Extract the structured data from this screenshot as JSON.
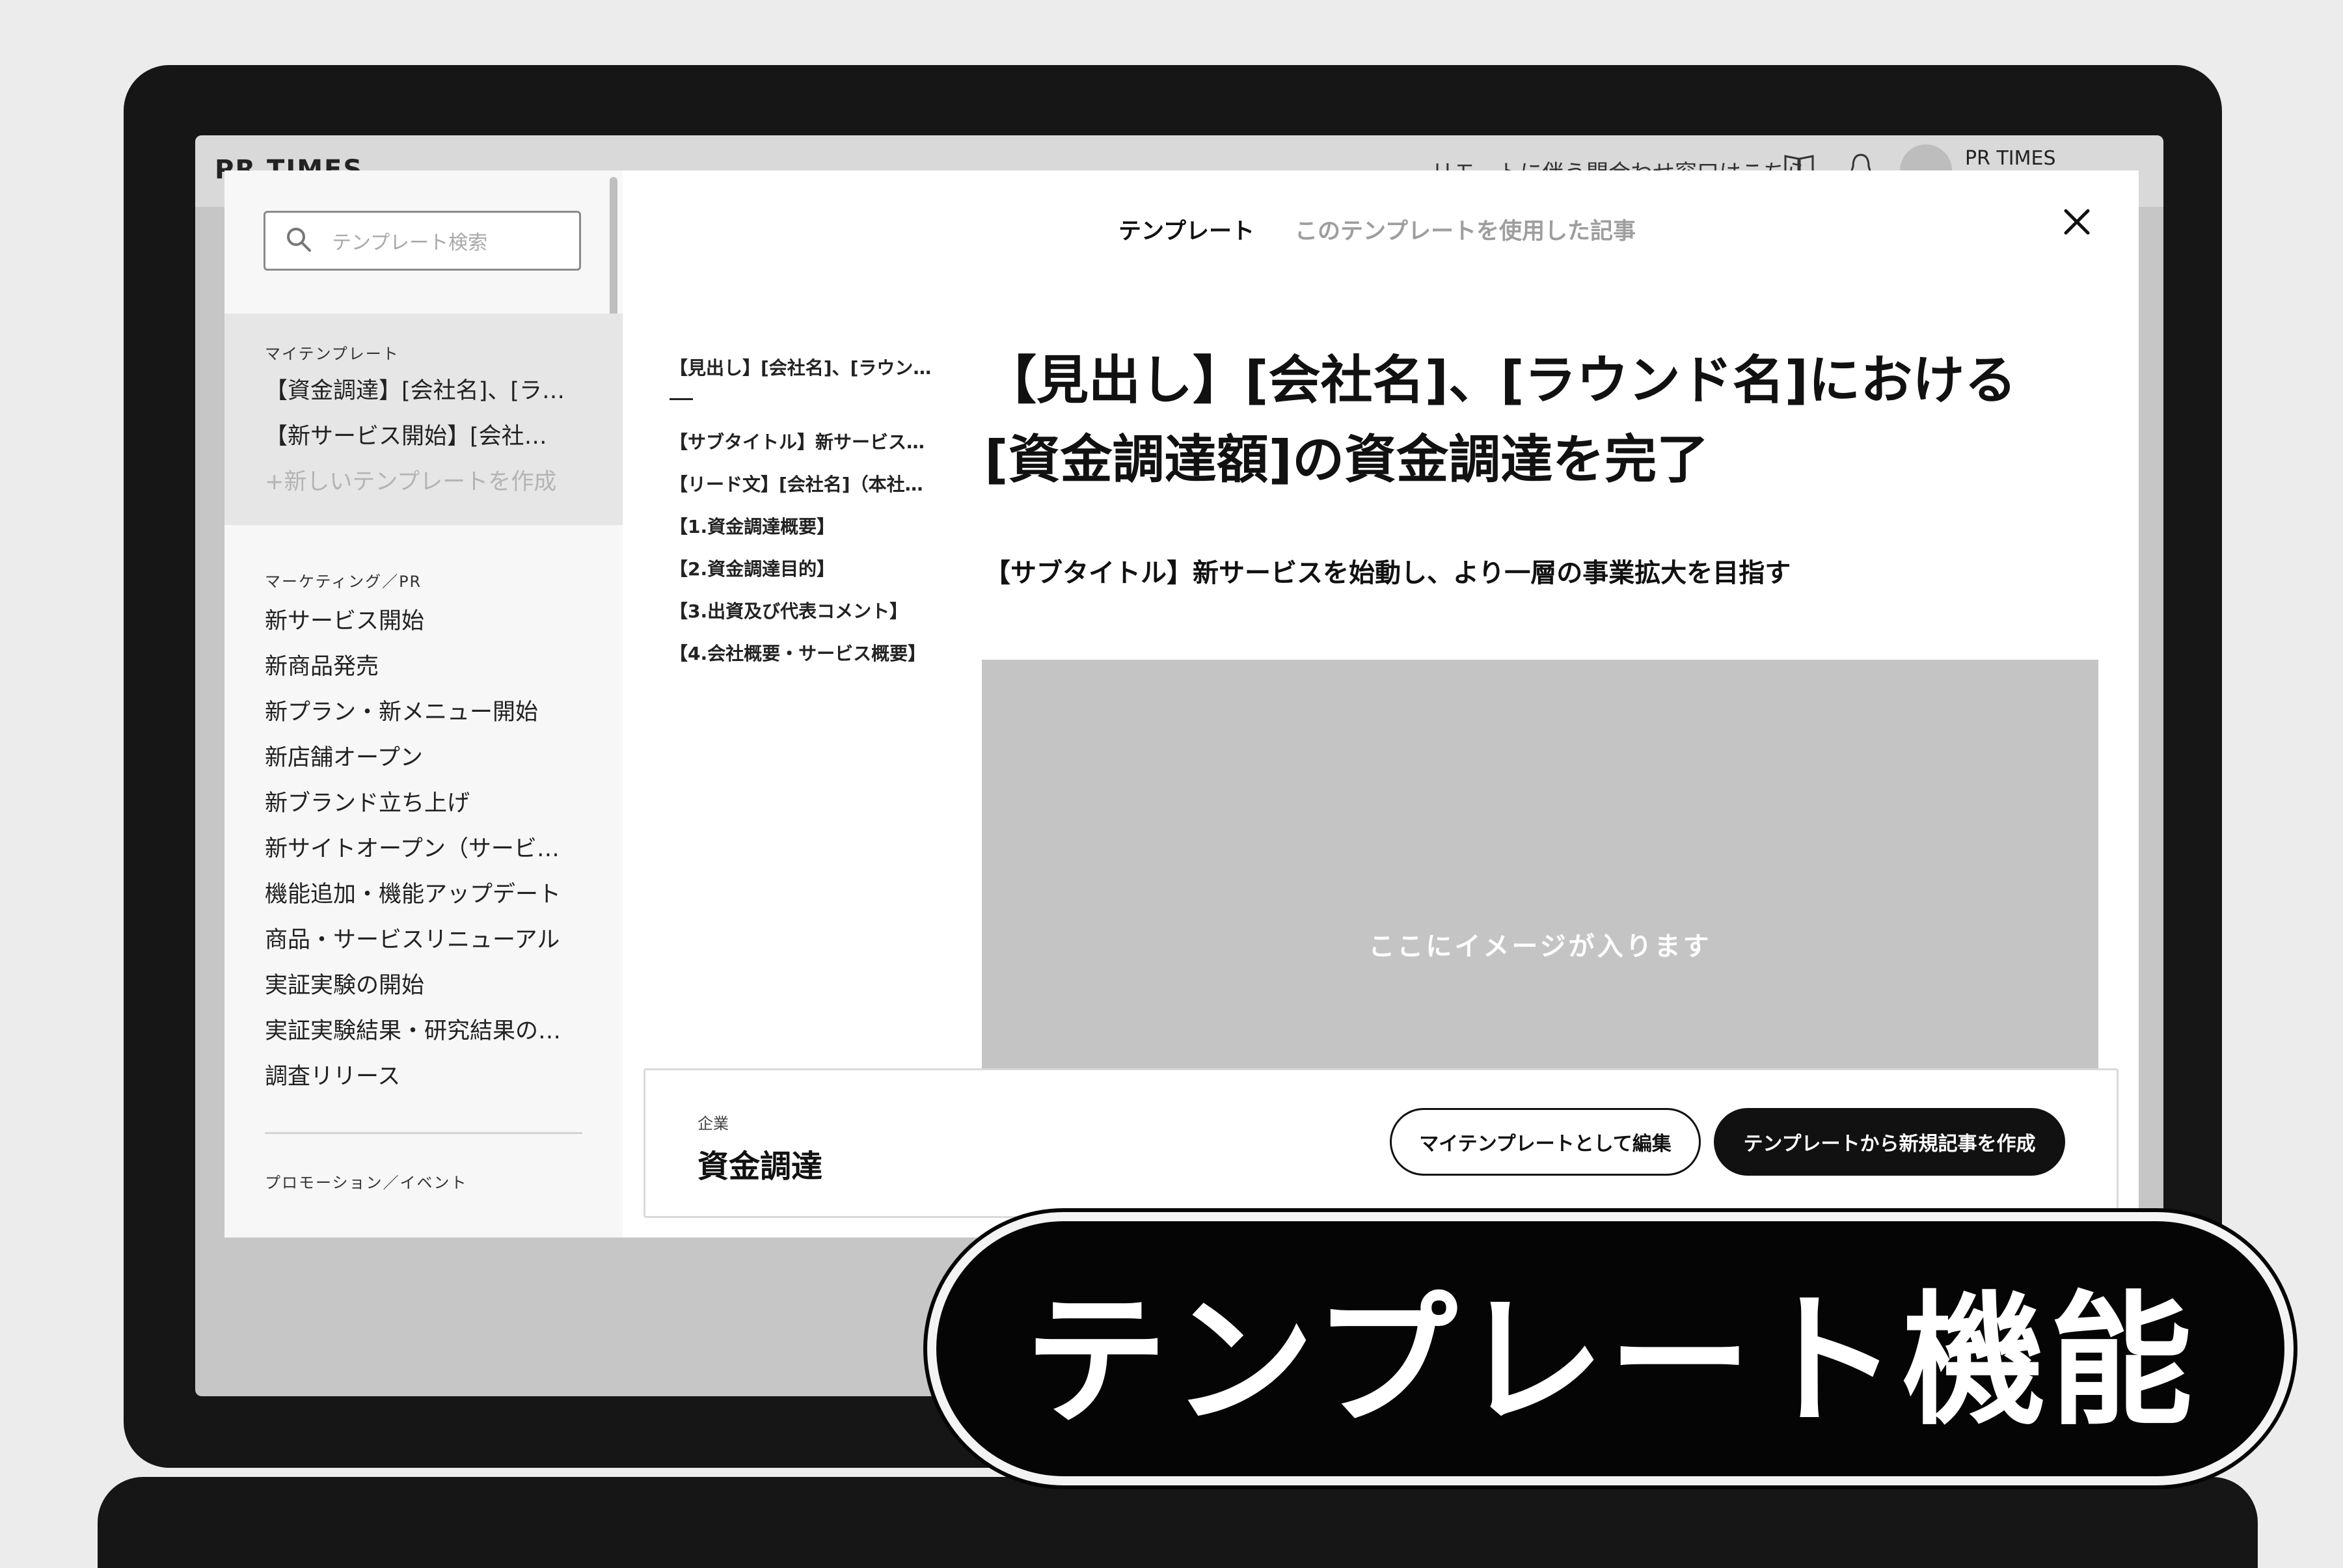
{
  "topbar": {
    "logo": "PR TIMES",
    "link": "リモートに伴う問合わせ窓口はこちら",
    "book_icon": "book-icon",
    "bell_icon": "bell-icon",
    "user_name": "PR TIMES"
  },
  "sidebar": {
    "search_placeholder": "テンプレート検索",
    "my_templates": {
      "label": "マイテンプレート",
      "items": [
        "【資金調達】[会社名]、[ラ…",
        "【新サービス開始】[会社…"
      ],
      "create_label": "+新しいテンプレートを作成"
    },
    "marketing": {
      "label": "マーケティング／PR",
      "items": [
        "新サービス開始",
        "新商品発売",
        "新プラン・新メニュー開始",
        "新店舗オープン",
        "新ブランド立ち上げ",
        "新サイトオープン（サービ…",
        "機能追加・機能アップデート",
        "商品・サービスリニューアル",
        "実証実験の開始",
        "実証実験結果・研究結果の…",
        "調査リリース"
      ]
    },
    "promotion": {
      "label": "プロモーション／イベント"
    }
  },
  "modal": {
    "tabs": [
      "テンプレート",
      "このテンプレートを使用した記事"
    ],
    "toc": [
      "【見出し】[会社名]、[ラウン…",
      "【サブタイトル】新サービス…",
      "【リード文】[会社名]（本社…",
      "【1.資金調達概要】",
      "【2.資金調達目的】",
      "【3.出資及び代表コメント】",
      "【4.会社概要・サービス概要】"
    ],
    "title": "【見出し】[会社名]、[ラウンド名]における[資金調達額]の資金調達を完了",
    "subtitle": "【サブタイトル】新サービスを始動し、より一層の事業拡大を目指す",
    "image_placeholder": "ここにイメージが入ります",
    "footer": {
      "category_label": "企業",
      "category_value": "資金調達",
      "edit_button": "マイテンプレートとして編集",
      "create_button": "テンプレートから新規記事を作成"
    }
  },
  "badge": {
    "text": "テンプレート機能"
  }
}
